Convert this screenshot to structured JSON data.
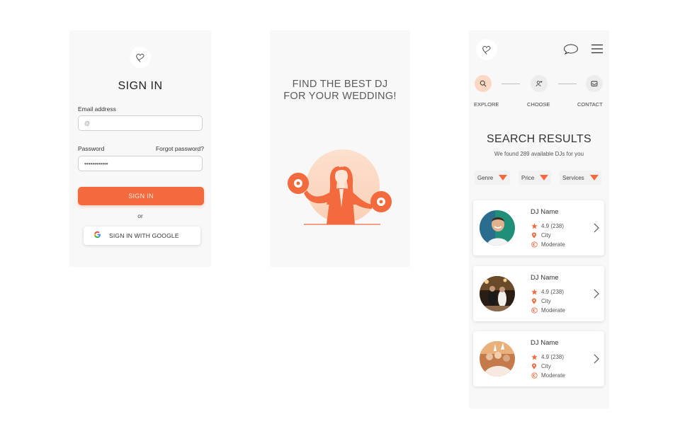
{
  "colors": {
    "accent": "#f26a3d",
    "accent_light": "#fcd8c4",
    "panel": "#f8f8f8"
  },
  "signin": {
    "title": "SIGN IN",
    "email_label": "Email address",
    "email_placeholder": "@",
    "password_label": "Password",
    "forgot_label": "Forgot password?",
    "password_value": "••••••••••••",
    "signin_button": "SIGN IN",
    "or_text": "or",
    "google_button": "SIGN IN WITH GOOGLE",
    "google_icon": "G"
  },
  "landing": {
    "title_line1": "FIND THE BEST DJ",
    "title_line2": "FOR YOUR WEDDING!",
    "illustration": "dj-woman-illustration"
  },
  "results": {
    "steps": [
      {
        "label": "EXPLORE",
        "icon": "search-icon",
        "active": true
      },
      {
        "label": "CHOOSE",
        "icon": "user-add-icon",
        "active": false
      },
      {
        "label": "CONTACT",
        "icon": "inbox-icon",
        "active": false
      }
    ],
    "title": "SEARCH RESULTS",
    "subtitle": "We found 289 available DJs for you",
    "filters": [
      "Genre",
      "Price",
      "Services"
    ],
    "cards": [
      {
        "name": "DJ Name",
        "rating": "4.9 (238)",
        "city": "City",
        "price": "Moderate",
        "avatar": "dj-photo-1"
      },
      {
        "name": "DJ Name",
        "rating": "4.9 (238)",
        "city": "City",
        "price": "Moderate",
        "avatar": "dj-photo-2"
      },
      {
        "name": "DJ Name",
        "rating": "4.9 (238)",
        "city": "City",
        "price": "Moderate",
        "avatar": "dj-photo-3"
      }
    ]
  }
}
